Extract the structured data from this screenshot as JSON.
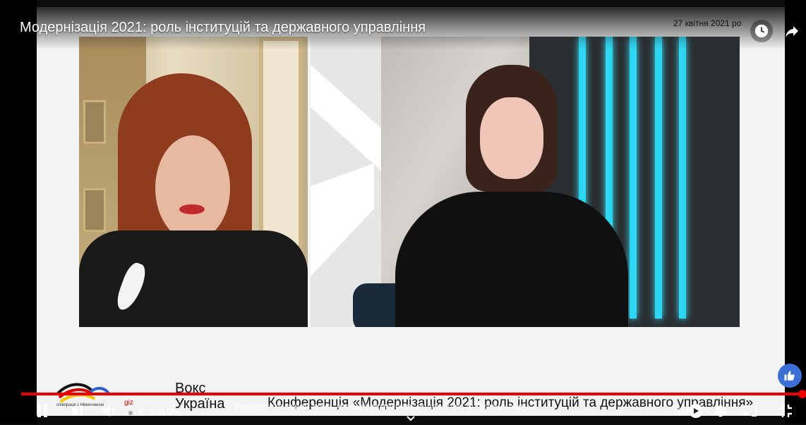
{
  "video": {
    "title": "Модернізація 2021: роль інституцій та державного управління",
    "date": "27 квітня 2021 ро",
    "brand_line1": "Вокс",
    "brand_line2": "Україна",
    "conference": "Конференція «Модернізація 2021: роль інституцій та державного управління»",
    "logo_text_1": "співпраця з Німеччиною",
    "logo_text_2": "giz"
  },
  "player": {
    "live_label": "В ЭФИРЕ",
    "scroll_hint": "Прокрутите экран вниз, чтобы посмотреть подробную информацию",
    "progress_color": "#e00000"
  },
  "icons": {
    "pause": "pause-icon",
    "next": "next-icon",
    "volume": "volume-icon",
    "clock": "clock-icon",
    "share": "share-icon",
    "like": "thumbs-up-icon",
    "settings": "gear-icon",
    "cast": "cast-icon",
    "exit_fullscreen": "exit-fullscreen-icon",
    "autoplay": "autoplay-toggle",
    "chevron": "chevron-down-icon"
  }
}
